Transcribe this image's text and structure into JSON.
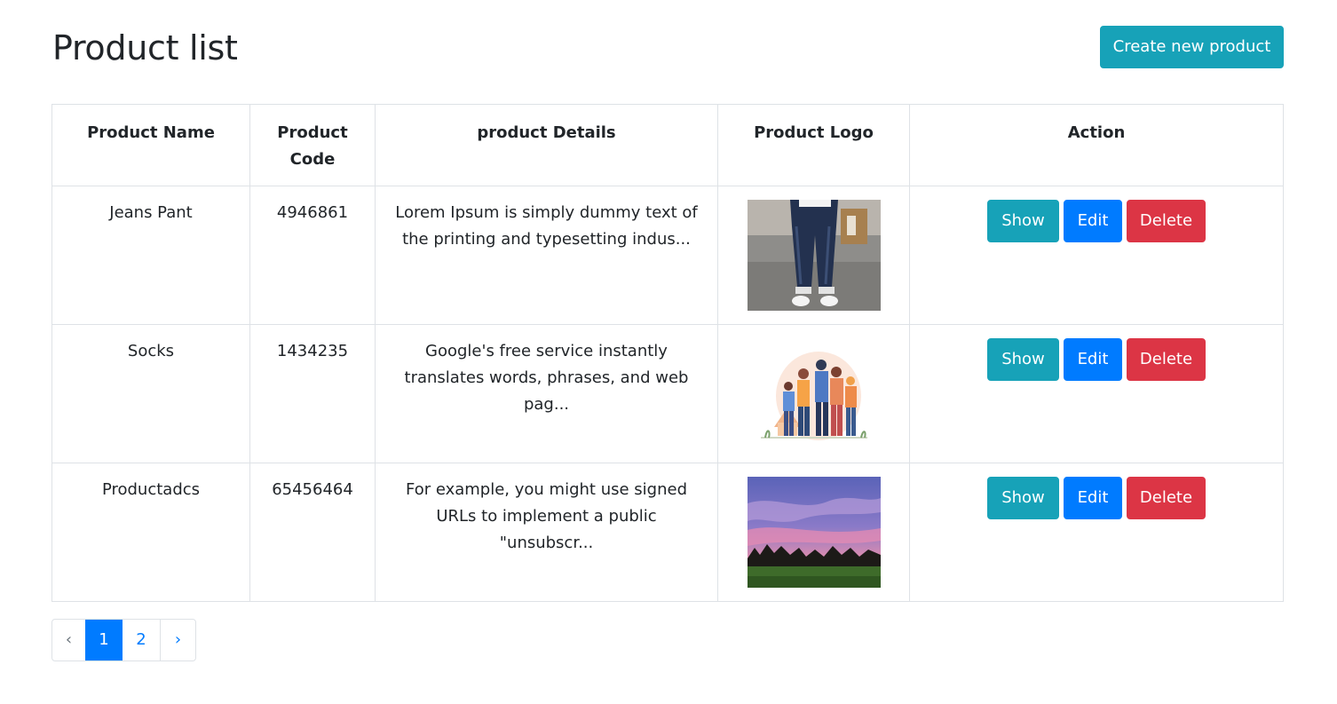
{
  "page": {
    "title": "Product list",
    "create_button": "Create new product"
  },
  "table": {
    "headers": [
      "Product Name",
      "Product Code",
      "product Details",
      "Product Logo",
      "Action"
    ],
    "rows": [
      {
        "name": "Jeans Pant",
        "code": "4946861",
        "details": "Lorem Ipsum is simply dummy text of the printing and typesetting indus...",
        "logo": "jeans-photo"
      },
      {
        "name": "Socks",
        "code": "1434235",
        "details": "Google's free service instantly translates words, phrases, and web pag...",
        "logo": "family-illustration"
      },
      {
        "name": "Productadcs",
        "code": "65456464",
        "details": "For example, you might use signed URLs to implement a public \"unsubscr...",
        "logo": "sunset-photo"
      }
    ],
    "actions": {
      "show": "Show",
      "edit": "Edit",
      "delete": "Delete"
    }
  },
  "pagination": {
    "prev": "‹",
    "pages": [
      "1",
      "2"
    ],
    "active_page": "1",
    "next": "›"
  },
  "colors": {
    "info": "#17a2b8",
    "primary": "#007bff",
    "danger": "#dc3545"
  }
}
